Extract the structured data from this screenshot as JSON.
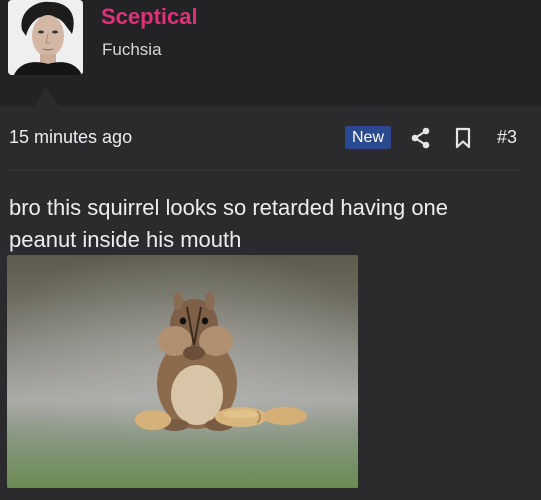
{
  "user": {
    "name": "Sceptical",
    "title": "Fuchsia"
  },
  "meta": {
    "timestamp": "15 minutes ago",
    "badge": "New",
    "post_number": "#3",
    "icons": [
      "share-icon",
      "bookmark-icon"
    ]
  },
  "post": {
    "text": "bro this squirrel looks so retarded having one peanut inside his mouth",
    "image_alt": "chipmunk holding a peanut with stuffed cheeks"
  },
  "colors": {
    "background": "#232325",
    "post_background": "#2b2b2e",
    "username": "#e0307a",
    "badge_background": "#294a8e"
  }
}
